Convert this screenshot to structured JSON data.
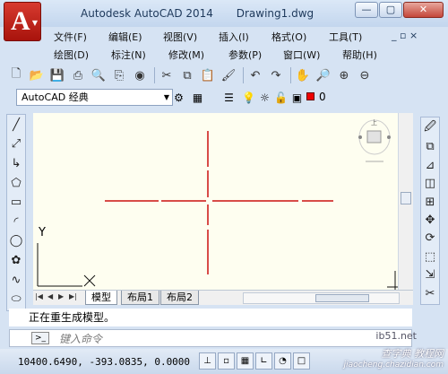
{
  "window": {
    "app_title": "Autodesk AutoCAD 2014",
    "file_name": "Drawing1.dwg",
    "app_button_letter": "A",
    "controls": {
      "minimize": "—",
      "restore": "▢",
      "close": "✕"
    }
  },
  "menu": {
    "row1": [
      "文件(F)",
      "编辑(E)",
      "视图(V)",
      "插入(I)",
      "格式(O)",
      "工具(T)"
    ],
    "row2": [
      "绘图(D)",
      "标注(N)",
      "修改(M)",
      "参数(P)",
      "窗口(W)",
      "帮助(H)"
    ],
    "doc_controls": "_ ▫ ×"
  },
  "toolbar": {
    "icons": [
      "new-file-icon",
      "open-icon",
      "save-icon",
      "print-icon",
      "preview-icon",
      "publish-icon",
      "plot-icon",
      "cut-icon",
      "copy-icon",
      "paste-icon",
      "match-props-icon",
      "undo-icon",
      "redo-icon",
      "pan-icon",
      "zoom-realtime-icon",
      "zoom-window-icon",
      "zoom-previous-icon"
    ]
  },
  "workspace": {
    "selected": "AutoCAD 经典",
    "layer_value": "0",
    "layer_color": "#ee0000"
  },
  "canvas": {
    "background": "#fefef0",
    "crosshair_color": "#cc1111",
    "ucs_y_label": "Y",
    "ucs_x_label": "X",
    "viewcube_label": "上"
  },
  "tabs": [
    {
      "label": "模型",
      "active": true
    },
    {
      "label": "布局1",
      "active": false
    },
    {
      "label": "布局2",
      "active": false
    }
  ],
  "command": {
    "history": "正在重生成模型。",
    "placeholder": "键入命令",
    "icon_text": ">_"
  },
  "status": {
    "coordinates": "10400.6490, -393.0835, 0.0000"
  },
  "watermark": {
    "line1": "查字典 教程网",
    "line2": "jiaocheng.chazidian.com",
    "site": "ib51.net"
  }
}
